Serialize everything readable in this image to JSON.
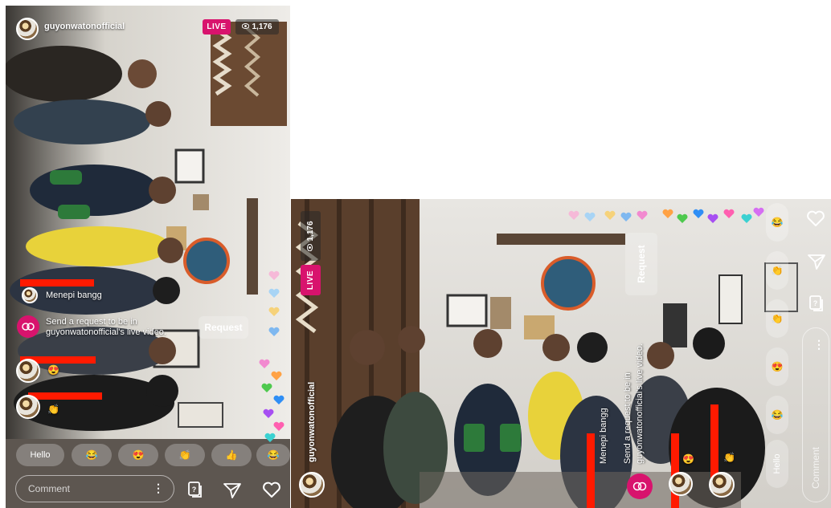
{
  "stream": {
    "username": "guyonwatonofficial",
    "live_label": "LIVE",
    "viewer_count": "1,176"
  },
  "comments": [
    {
      "username": "",
      "text": "Menepi bangg"
    },
    {
      "username": "",
      "text": "😍"
    },
    {
      "username": "",
      "text": "👏"
    }
  ],
  "request_prompt": {
    "text_a": "Send a request to be in guyonwatonofficial's live video.",
    "text_b_line1": "Send a request to be in",
    "text_b_line2": "guyonwatonofficial's live video.",
    "button_label": "Request"
  },
  "quick_reactions": [
    "Hello",
    "😂",
    "😍",
    "👏",
    "👍",
    "😂"
  ],
  "quick_reactions_b": [
    "Hello",
    "😂",
    "😍",
    "👏"
  ],
  "composer": {
    "placeholder": "Comment",
    "more_label": "⋮"
  },
  "colors": {
    "live_badge": "#d8136d",
    "redaction_bar": "#ff1a00",
    "invite_icon": "#d8136d"
  },
  "icons": [
    "eye-icon",
    "invite-icon",
    "question-box-icon",
    "send-icon",
    "heart-icon",
    "more-icon"
  ]
}
